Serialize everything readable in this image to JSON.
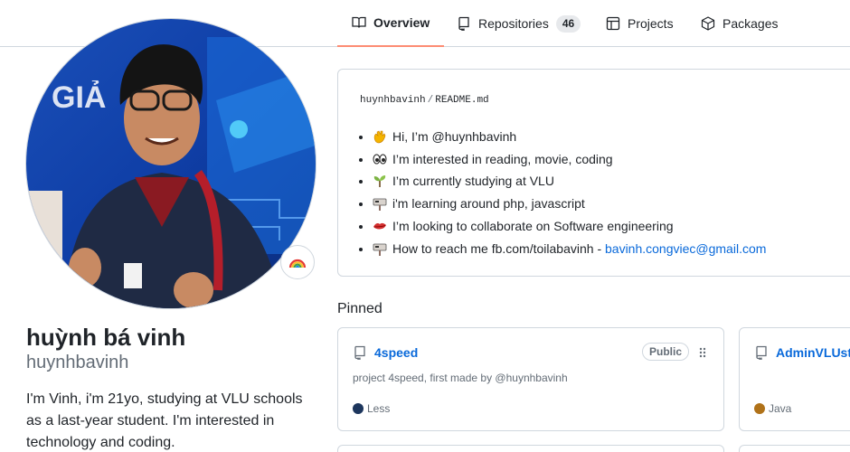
{
  "tabs": [
    {
      "label": "Overview",
      "icon": "book-icon",
      "active": true
    },
    {
      "label": "Repositories",
      "icon": "repo-icon",
      "count": "46"
    },
    {
      "label": "Projects",
      "icon": "table-icon"
    },
    {
      "label": "Packages",
      "icon": "package-icon"
    }
  ],
  "profile": {
    "full_name": "huỳnh bá vinh",
    "login": "huynhbavinh",
    "bio": "I'm Vinh, i'm 21yo, studying at VLU schools as a last-year student. I'm interested in technology and coding.",
    "status_emoji": "rainbow-icon"
  },
  "readme": {
    "owner": "huynhbavinh",
    "separator": "/",
    "file": "README.md",
    "items": [
      {
        "icon": "wave-icon",
        "text": "Hi, I’m @huynhbavinh"
      },
      {
        "icon": "eyes-icon",
        "text": "I’m interested in reading, movie, coding"
      },
      {
        "icon": "seedling-icon",
        "text": "I’m currently studying at VLU"
      },
      {
        "icon": "mailbox-icon",
        "text": "i'm learning around php, javascript"
      },
      {
        "icon": "lips-icon",
        "text": "I’m looking to collaborate on Software engineering"
      },
      {
        "icon": "mailbox-icon",
        "text": "How to reach me fb.com/toilabavinh - ",
        "link": "bavinh.congviec@gmail.com"
      }
    ]
  },
  "pinned": {
    "title": "Pinned",
    "cards": [
      {
        "name": "4speed",
        "visibility": "Public",
        "description": "project 4speed, first made by @huynhbavinh",
        "language": "Less",
        "language_color": "#1d365d"
      },
      {
        "name": "AdminVLUsto",
        "visibility": "",
        "description": "",
        "language": "Java",
        "language_color": "#b07219"
      }
    ]
  },
  "colors": {
    "accent_tab": "#fd8c73",
    "link": "#0969da",
    "border": "#d0d7de"
  }
}
